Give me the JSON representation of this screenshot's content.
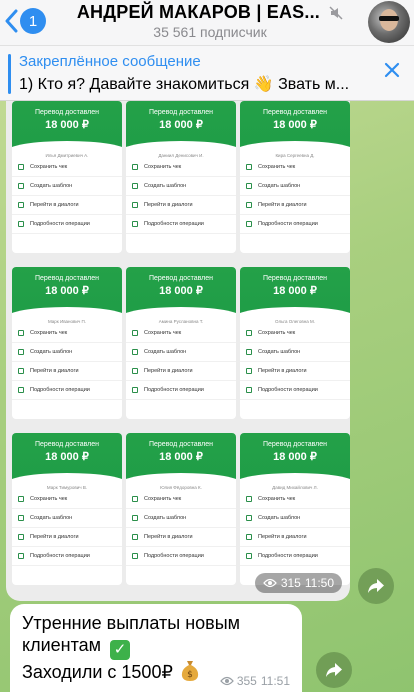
{
  "header": {
    "badge_count": "1",
    "channel_title": "АНДРЕЙ МАКАРОВ | EAS...",
    "subscribers": "35 561 подписчик"
  },
  "pinned": {
    "label": "Закреплённое сообщение",
    "text": "1) Кто я? Давайте знакомиться 👋 Звать м..."
  },
  "photo_message": {
    "views": "315",
    "time": "11:50",
    "cards": [
      {
        "title": "Перевод доставлен",
        "amount": "18 000 ₽",
        "name": "Илья Дмитриевич А.",
        "rows": [
          "Сохранить чек",
          "Создать шаблон",
          "Перейти в диалоги",
          "Подробности операции"
        ]
      },
      {
        "title": "Перевод доставлен",
        "amount": "18 000 ₽",
        "name": "Даниил Денисович И.",
        "rows": [
          "Сохранить чек",
          "Создать шаблон",
          "Перейти в диалоги",
          "Подробности операции"
        ]
      },
      {
        "title": "Перевод доставлен",
        "amount": "18 000 ₽",
        "name": "Кира Сергеевна Д.",
        "rows": [
          "Сохранить чек",
          "Создать шаблон",
          "Перейти в диалоги",
          "Подробности операции"
        ]
      },
      {
        "title": "Перевод доставлен",
        "amount": "18 000 ₽",
        "name": "Марк Иванович П.",
        "rows": [
          "Сохранить чек",
          "Создать шаблон",
          "Перейти в диалоги",
          "Подробности операции"
        ]
      },
      {
        "title": "Перевод доставлен",
        "amount": "18 000 ₽",
        "name": "Амина Руслановна Т.",
        "rows": [
          "Сохранить чек",
          "Создать шаблон",
          "Перейти в диалоги",
          "Подробности операции"
        ]
      },
      {
        "title": "Перевод доставлен",
        "amount": "18 000 ₽",
        "name": "Ольга Олеговна М.",
        "rows": [
          "Сохранить чек",
          "Создать шаблон",
          "Перейти в диалоги",
          "Подробности операции"
        ]
      },
      {
        "title": "Перевод доставлен",
        "amount": "18 000 ₽",
        "name": "Марк Тимурович В.",
        "rows": [
          "Сохранить чек",
          "Создать шаблон",
          "Перейти в диалоги",
          "Подробности операции"
        ]
      },
      {
        "title": "Перевод доставлен",
        "amount": "18 000 ₽",
        "name": "Юлия Фёдоровна К.",
        "rows": [
          "Сохранить чек",
          "Создать шаблон",
          "Перейти в диалоги",
          "Подробности операции"
        ]
      },
      {
        "title": "Перевод доставлен",
        "amount": "18 000 ₽",
        "name": "Давид Михайлович Л.",
        "rows": [
          "Сохранить чек",
          "Создать шаблон",
          "Перейти в диалоги",
          "Подробности операции"
        ]
      }
    ]
  },
  "text_message": {
    "line1": "Утренние выплаты новым",
    "line2": "клиентам",
    "line3": "Заходили с 1500₽",
    "views": "355",
    "time": "11:51"
  },
  "colors": {
    "accent": "#2f8ef0",
    "card_green": "#21a048"
  }
}
